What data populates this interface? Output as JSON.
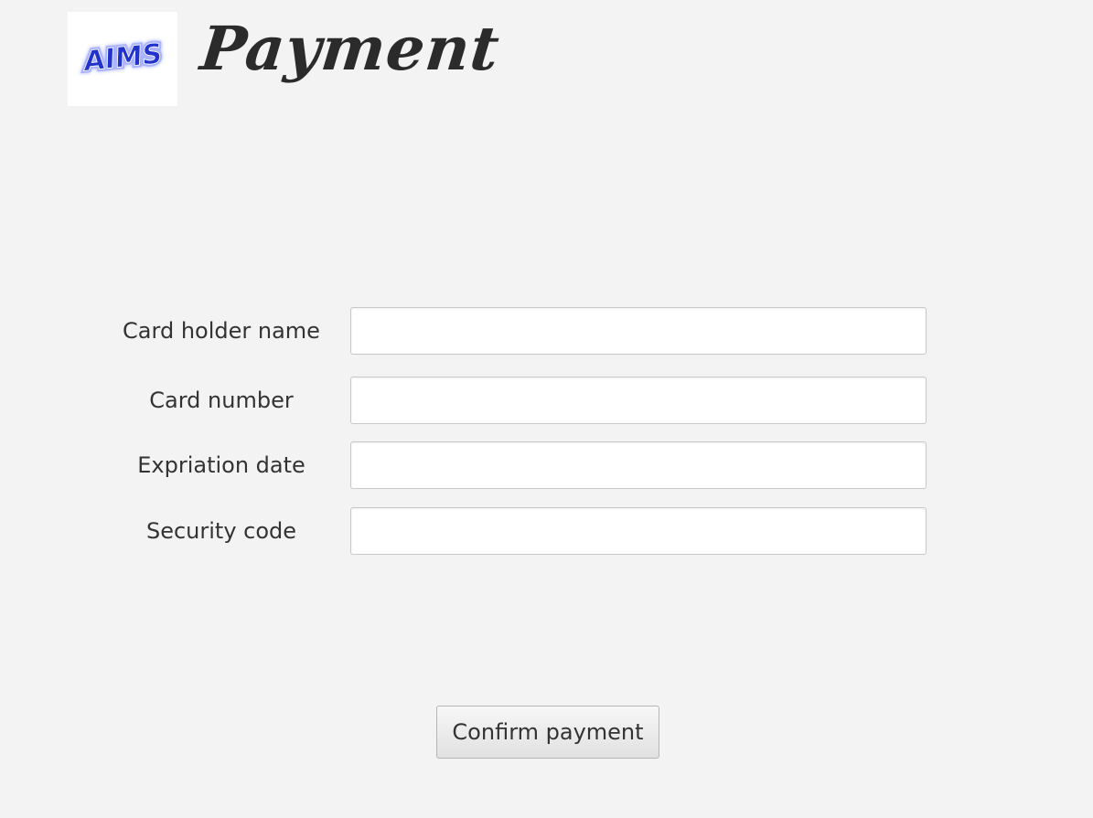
{
  "header": {
    "logo_text": "AIMS",
    "title": "Payment"
  },
  "form": {
    "fields": [
      {
        "label": "Card holder name",
        "value": "",
        "placeholder": ""
      },
      {
        "label": "Card number",
        "value": "",
        "placeholder": ""
      },
      {
        "label": "Expriation date",
        "value": "",
        "placeholder": ""
      },
      {
        "label": "Security code",
        "value": "",
        "placeholder": ""
      }
    ],
    "confirm_label": "Confirm payment"
  },
  "colors": {
    "background": "#f3f3f3",
    "logo_blue": "#2233cc",
    "title_text": "#2b2b2b"
  }
}
